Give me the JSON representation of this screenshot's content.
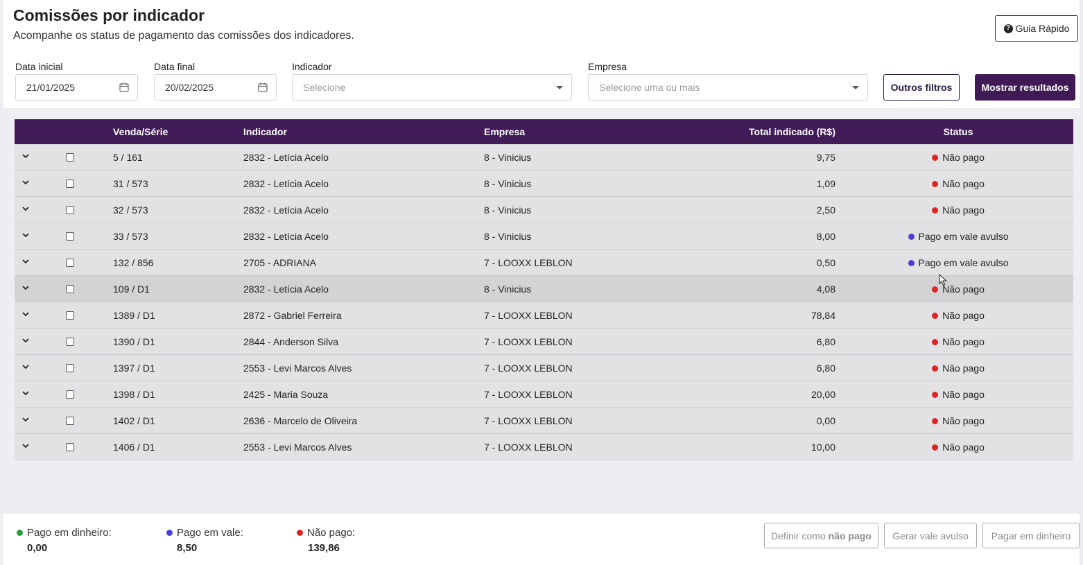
{
  "header": {
    "title": "Comissões por indicador",
    "subtitle": "Acompanhe os status de pagamento das comissões dos indicadores.",
    "guide_button": "Guia Rápido"
  },
  "filters": {
    "start_date": {
      "label": "Data inicial",
      "value": "21/01/2025"
    },
    "end_date": {
      "label": "Data final",
      "value": "20/02/2025"
    },
    "indicator": {
      "label": "Indicador",
      "placeholder": "Selecione"
    },
    "company": {
      "label": "Empresa",
      "placeholder": "Selecione uma ou mais"
    },
    "other_filters_button": "Outros filtros",
    "show_results_button": "Mostrar resultados"
  },
  "table": {
    "columns": {
      "venda": "Venda/Série",
      "indicador": "Indicador",
      "empresa": "Empresa",
      "total": "Total indicado (R$)",
      "status": "Status"
    },
    "rows": [
      {
        "venda": "5 / 161",
        "indicador": "2832 - Letícia Acelo",
        "empresa": "8 - Vinicius",
        "total": "9,75",
        "status": "Não pago",
        "status_color": "#e02424"
      },
      {
        "venda": "31 / 573",
        "indicador": "2832 - Letícia Acelo",
        "empresa": "8 - Vinicius",
        "total": "1,09",
        "status": "Não pago",
        "status_color": "#e02424"
      },
      {
        "venda": "32 / 573",
        "indicador": "2832 - Letícia Acelo",
        "empresa": "8 - Vinicius",
        "total": "2,50",
        "status": "Não pago",
        "status_color": "#e02424"
      },
      {
        "venda": "33 / 573",
        "indicador": "2832 - Letícia Acelo",
        "empresa": "8 - Vinicius",
        "total": "8,00",
        "status": "Pago em vale avulso",
        "status_color": "#4a3fd6"
      },
      {
        "venda": "132 / 856",
        "indicador": "2705 - ADRIANA",
        "empresa": "7 - LOOXX LEBLON",
        "total": "0,50",
        "status": "Pago em vale avulso",
        "status_color": "#4a3fd6"
      },
      {
        "venda": "109 / D1",
        "indicador": "2832 - Letícia Acelo",
        "empresa": "8 - Vinicius",
        "total": "4,08",
        "status": "Não pago",
        "status_color": "#e02424"
      },
      {
        "venda": "1389 / D1",
        "indicador": "2872 - Gabriel Ferreira",
        "empresa": "7 - LOOXX LEBLON",
        "total": "78,84",
        "status": "Não pago",
        "status_color": "#e02424"
      },
      {
        "venda": "1390 / D1",
        "indicador": "2844 - Anderson Silva",
        "empresa": "7 - LOOXX LEBLON",
        "total": "6,80",
        "status": "Não pago",
        "status_color": "#e02424"
      },
      {
        "venda": "1397 / D1",
        "indicador": "2553 - Levi Marcos Alves",
        "empresa": "7 - LOOXX LEBLON",
        "total": "6,80",
        "status": "Não pago",
        "status_color": "#e02424"
      },
      {
        "venda": "1398 / D1",
        "indicador": "2425 - Maria Souza",
        "empresa": "7 - LOOXX LEBLON",
        "total": "20,00",
        "status": "Não pago",
        "status_color": "#e02424"
      },
      {
        "venda": "1402 / D1",
        "indicador": "2636 - Marcelo de Oliveira",
        "empresa": "7 - LOOXX LEBLON",
        "total": "0,00",
        "status": "Não pago",
        "status_color": "#e02424"
      },
      {
        "venda": "1406 / D1",
        "indicador": "2553 - Levi Marcos Alves",
        "empresa": "7 - LOOXX LEBLON",
        "total": "10,00",
        "status": "Não pago",
        "status_color": "#e02424"
      }
    ]
  },
  "summary": {
    "cash": {
      "label": "Pago em dinheiro:",
      "value": "0,00",
      "color": "#22a03a"
    },
    "voucher": {
      "label": "Pago em vale:",
      "value": "8,50",
      "color": "#4a3fd6"
    },
    "unpaid": {
      "label": "Não pago:",
      "value": "139,86",
      "color": "#e02424"
    }
  },
  "actions": {
    "set_unpaid_prefix": "Definir como",
    "set_unpaid_bold": "não pago",
    "generate_voucher": "Gerar vale avulso",
    "pay_cash": "Pagar em dinheiro"
  }
}
